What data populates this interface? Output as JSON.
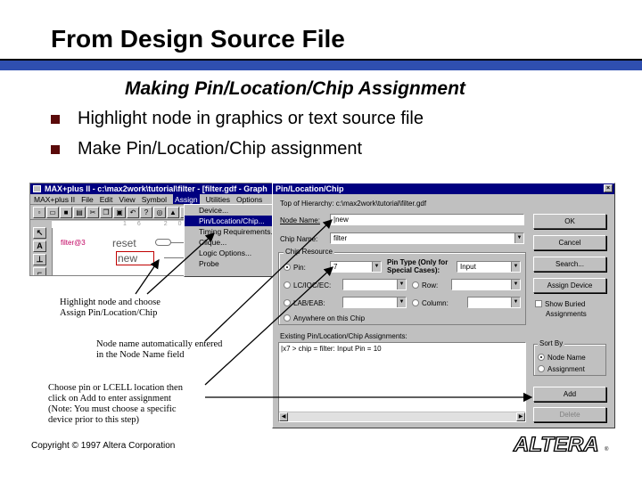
{
  "slide": {
    "title": "From Design Source File",
    "subtitle": "Making Pin/Location/Chip Assignment",
    "bullets": [
      "Highlight node in graphics or text source file",
      "Make Pin/Location/Chip assignment"
    ],
    "captions": {
      "c1": [
        "Highlight node and choose",
        "Assign Pin/Location/Chip"
      ],
      "c2": [
        "Node name automatically entered",
        "in the Node Name field"
      ],
      "c3": [
        "Choose pin or LCELL location then",
        "click on Add to enter assignment"
      ],
      "c3_bold": [
        "(Note: You must choose a specific",
        "device prior to this step)"
      ]
    },
    "copyright": "Copyright © 1997 Altera Corporation",
    "logo": "ALTERA",
    "logo_mark": "®",
    "colors": {
      "title_rule": "#2f4fb0",
      "bullet": "#5a0a0a",
      "titlebar": "#000080"
    }
  },
  "maxplus": {
    "title": "MAX+plus II - c:\\max2work\\tutorial\\filter - [filter.gdf - Graph",
    "menu": [
      "MAX+plus II",
      "File",
      "Edit",
      "View",
      "Symbol",
      "Assign",
      "Utilities",
      "Options"
    ],
    "toolbar_icons": [
      "new-file-icon",
      "open-icon",
      "save-icon",
      "print-icon",
      "cut-icon",
      "copy-icon",
      "paste-icon",
      "undo-icon",
      "help-icon",
      "zoom-icon",
      "hierarchy-icon",
      "compile-icon"
    ],
    "palette": [
      "↖",
      "A",
      "⊥",
      "⌐"
    ],
    "ruler": "16 20",
    "nodes": {
      "filter": "filter@3",
      "reset": "reset",
      "new": "new"
    },
    "assign_menu": [
      "Device...",
      "Pin/Location/Chip...",
      "Timing Requirements...",
      "Clique...",
      "Logic Options...",
      "Probe"
    ]
  },
  "dialog": {
    "title": "Pin/Location/Chip",
    "close": "×",
    "hierarchy": "Top of Hierarchy:  c:\\max2work\\tutorial\\filter.gdf",
    "node_name_label": "Node Name:",
    "node_name_value": "|new",
    "chip_name_label": "Chip Name:",
    "chip_name_value": "filter",
    "chip_resource_label": "Chip Resource",
    "pin_label": "Pin:",
    "pin_value": "7",
    "pin_type_label": [
      "Pin Type (Only for",
      "Special Cases):"
    ],
    "pin_type_value": "Input",
    "lc_label": "LC/IOC/EC:",
    "row_label": "Row:",
    "lab_label": "LAB/EAB:",
    "column_label": "Column:",
    "anywhere_label": "Anywhere on this Chip",
    "existing_label": "Existing Pin/Location/Chip Assignments:",
    "assignments": [
      "|x7 > chip = filter: Input Pin = 10"
    ],
    "buttons": {
      "ok": "OK",
      "cancel": "Cancel",
      "search": "Search...",
      "assign_device": "Assign Device",
      "add": "Add",
      "delete": "Delete"
    },
    "show_buried": [
      "Show Buried",
      "Assignments"
    ],
    "sort_by_label": "Sort By",
    "sort_options": [
      "Node Name",
      "Assignment"
    ]
  }
}
